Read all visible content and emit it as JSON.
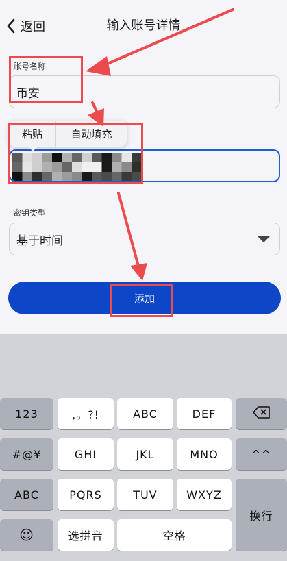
{
  "header": {
    "back_label": "返回",
    "title": "输入账号详情"
  },
  "form": {
    "account_name_label": "账号名称",
    "account_name_value": "币安",
    "key_type_label": "密钥类型",
    "key_type_value": "基于时间",
    "add_button_label": "添加"
  },
  "paste_menu": {
    "paste_label": "粘贴",
    "autofill_label": "自动填充"
  },
  "keyboard": {
    "rows": [
      [
        "123",
        ",。?!",
        "ABC",
        "DEF",
        "⌫"
      ],
      [
        "#@¥",
        "GHI",
        "JKL",
        "MNO",
        "^^"
      ],
      [
        "ABC",
        "PQRS",
        "TUV",
        "WXYZ",
        "换行"
      ],
      [
        "☺",
        "选拼音",
        "空格"
      ]
    ]
  },
  "colors": {
    "accent": "#0d47c7",
    "focus_border": "#1f5ed1",
    "annotation": "#ec4b4e",
    "background": "#f5f4f9",
    "keyboard_bg": "#d1d3d9"
  },
  "icons": {
    "back": "chevron-left-icon",
    "dropdown": "triangle-down-icon",
    "backspace": "backspace-icon",
    "emoji": "emoji-icon",
    "annotation_arrows": "arrow-icon"
  }
}
